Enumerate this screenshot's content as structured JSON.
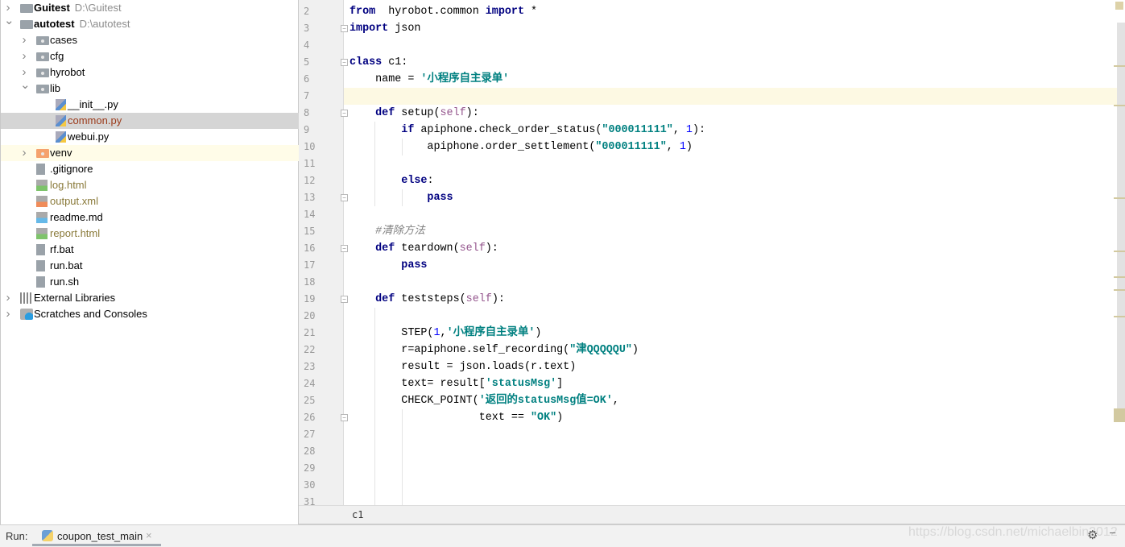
{
  "tree": [
    {
      "label": "Guitest",
      "path": "D:\\Guitest",
      "depth": 0,
      "arrow": "right",
      "icon": "folder-icon",
      "bold": true
    },
    {
      "label": "autotest",
      "path": "D:\\autotest",
      "depth": 0,
      "arrow": "down",
      "icon": "folder-icon",
      "bold": true
    },
    {
      "label": "cases",
      "depth": 1,
      "arrow": "right",
      "icon": "folder-icon"
    },
    {
      "label": "cfg",
      "depth": 1,
      "arrow": "right",
      "icon": "folder-icon"
    },
    {
      "label": "hyrobot",
      "depth": 1,
      "arrow": "right",
      "icon": "folder-icon"
    },
    {
      "label": "lib",
      "depth": 1,
      "arrow": "down",
      "icon": "folder-icon"
    },
    {
      "label": "__init__.py",
      "depth": 2,
      "icon": "python-file-icon"
    },
    {
      "label": "common.py",
      "depth": 2,
      "icon": "python-file-icon",
      "selected": true,
      "color": "modified"
    },
    {
      "label": "webui.py",
      "depth": 2,
      "icon": "python-file-icon"
    },
    {
      "label": "venv",
      "depth": 1,
      "arrow": "right",
      "icon": "excluded-folder-icon",
      "highlight": true
    },
    {
      "label": ".gitignore",
      "depth": 1,
      "icon": "gitignore-file-icon"
    },
    {
      "label": "log.html",
      "depth": 1,
      "icon": "html-file-icon",
      "color": "ignored"
    },
    {
      "label": "output.xml",
      "depth": 1,
      "icon": "xml-file-icon",
      "color": "ignored"
    },
    {
      "label": "readme.md",
      "depth": 1,
      "icon": "markdown-file-icon"
    },
    {
      "label": "report.html",
      "depth": 1,
      "icon": "html-file-icon",
      "color": "ignored"
    },
    {
      "label": "rf.bat",
      "depth": 1,
      "icon": "text-file-icon"
    },
    {
      "label": "run.bat",
      "depth": 1,
      "icon": "text-file-icon"
    },
    {
      "label": "run.sh",
      "depth": 1,
      "icon": "shell-file-icon"
    },
    {
      "label": "External Libraries",
      "depth": 0,
      "arrow": "right",
      "icon": "library-icon"
    },
    {
      "label": "Scratches and Consoles",
      "depth": 0,
      "arrow": "right",
      "icon": "scratches-icon"
    }
  ],
  "editor": {
    "current_line": 7,
    "lines": [
      {
        "n": "2",
        "t": [
          [
            "kw",
            "from"
          ],
          [
            "",
            "  hyrobot.common "
          ],
          [
            "kw",
            "import"
          ],
          [
            "",
            " *"
          ]
        ]
      },
      {
        "n": "3",
        "t": [
          [
            "kw",
            "import"
          ],
          [
            "",
            " json"
          ]
        ]
      },
      {
        "n": "4",
        "t": []
      },
      {
        "n": "5",
        "t": [
          [
            "kw",
            "class"
          ],
          [
            "",
            " c1:"
          ]
        ]
      },
      {
        "n": "6",
        "t": [
          [
            "",
            "    name = "
          ],
          [
            "str",
            "'小程序自主录单'"
          ]
        ]
      },
      {
        "n": "7",
        "t": []
      },
      {
        "n": "8",
        "t": [
          [
            "kw",
            "    def"
          ],
          [
            "",
            " setup("
          ],
          [
            "self",
            "self"
          ],
          [
            "",
            "):"
          ]
        ]
      },
      {
        "n": "9",
        "t": [
          [
            "kw",
            "        if"
          ],
          [
            "",
            " apiphone.check_order_status("
          ],
          [
            "str",
            "\"000011111\""
          ],
          [
            "",
            ", "
          ],
          [
            "num",
            "1"
          ],
          [
            "",
            "):"
          ]
        ]
      },
      {
        "n": "10",
        "t": [
          [
            "",
            "            apiphone.order_settlement("
          ],
          [
            "str",
            "\"000011111\""
          ],
          [
            "",
            ", "
          ],
          [
            "num",
            "1"
          ],
          [
            "",
            ")"
          ]
        ]
      },
      {
        "n": "11",
        "t": []
      },
      {
        "n": "12",
        "t": [
          [
            "kw",
            "        else"
          ],
          [
            "",
            ":"
          ]
        ]
      },
      {
        "n": "13",
        "t": [
          [
            "kw",
            "            pass"
          ]
        ]
      },
      {
        "n": "14",
        "t": []
      },
      {
        "n": "15",
        "t": [
          [
            "cmt",
            "    #清除方法"
          ]
        ]
      },
      {
        "n": "16",
        "t": [
          [
            "kw",
            "    def"
          ],
          [
            "",
            " teardown("
          ],
          [
            "self",
            "self"
          ],
          [
            "",
            "):"
          ]
        ]
      },
      {
        "n": "17",
        "t": [
          [
            "kw",
            "        pass"
          ]
        ]
      },
      {
        "n": "18",
        "t": []
      },
      {
        "n": "19",
        "t": [
          [
            "kw",
            "    def"
          ],
          [
            "",
            " teststeps("
          ],
          [
            "self",
            "self"
          ],
          [
            "",
            "):"
          ]
        ]
      },
      {
        "n": "20",
        "t": []
      },
      {
        "n": "21",
        "t": [
          [
            "",
            "        STEP("
          ],
          [
            "num",
            "1"
          ],
          [
            "",
            ","
          ],
          [
            "str",
            "'小程序自主录单'"
          ],
          [
            "",
            ")"
          ]
        ]
      },
      {
        "n": "22",
        "t": [
          [
            "",
            "        r=apiphone.self_recording("
          ],
          [
            "str",
            "\"津QQQQQU\""
          ],
          [
            "",
            ")"
          ]
        ]
      },
      {
        "n": "23",
        "t": [
          [
            "",
            "        result = json.loads(r.text)"
          ]
        ]
      },
      {
        "n": "24",
        "t": [
          [
            "",
            "        text= result["
          ],
          [
            "str",
            "'statusMsg'"
          ],
          [
            "",
            "]"
          ]
        ]
      },
      {
        "n": "25",
        "t": [
          [
            "",
            "        CHECK_POINT("
          ],
          [
            "str",
            "'返回的statusMsg值=OK'"
          ],
          [
            "",
            ","
          ]
        ]
      },
      {
        "n": "26",
        "t": [
          [
            "",
            "                    text == "
          ],
          [
            "str",
            "\"OK\""
          ],
          [
            "",
            ")"
          ]
        ]
      },
      {
        "n": "27",
        "t": []
      },
      {
        "n": "28",
        "t": []
      },
      {
        "n": "29",
        "t": []
      },
      {
        "n": "30",
        "t": []
      },
      {
        "n": "31",
        "t": []
      }
    ]
  },
  "breadcrumb": "c1",
  "run": {
    "label": "Run:",
    "tab": "coupon_test_main",
    "close": "×"
  },
  "watermark": "https://blog.csdn.net/michaelbin2012",
  "colors": {
    "keyword": "#000080",
    "string": "#008080",
    "number": "#0000ff",
    "self": "#94558d",
    "comment": "#808080",
    "selected_row": "#d5d5d5",
    "current_line": "#fdf9e3"
  }
}
